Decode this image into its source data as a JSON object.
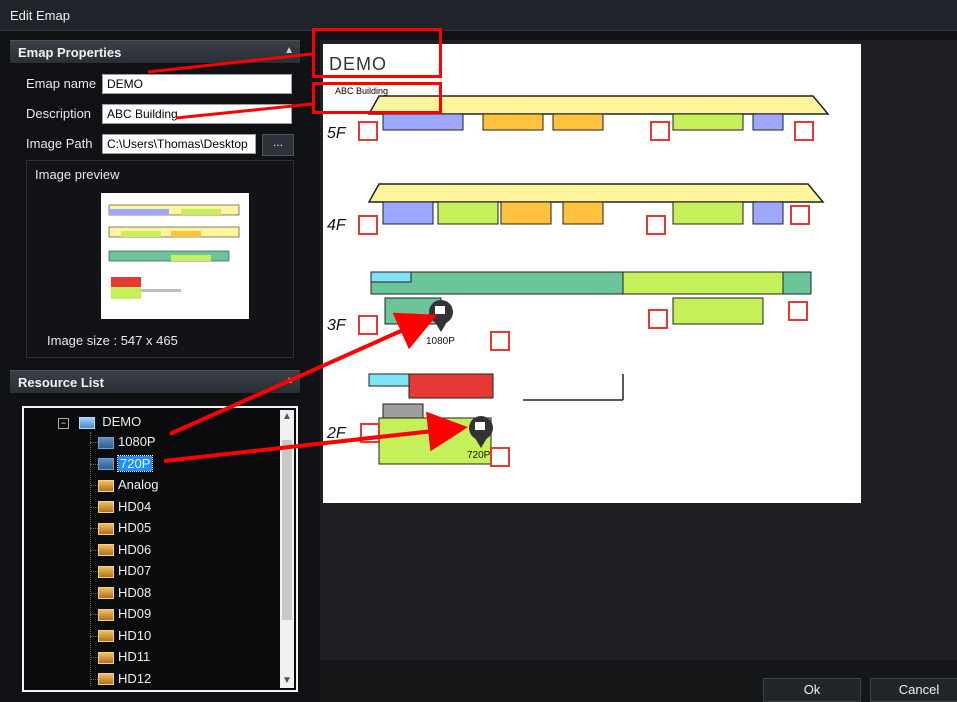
{
  "window": {
    "title": "Edit Emap"
  },
  "properties": {
    "header": "Emap Properties",
    "emap_name_label": "Emap name",
    "emap_name_value": "DEMO",
    "description_label": "Description",
    "description_value": "ABC Building",
    "image_path_label": "Image Path",
    "image_path_value": "C:\\Users\\Thomas\\Desktop",
    "browse_label": "...",
    "preview_title": "Image preview",
    "image_size": "Image size : 547 x 465"
  },
  "resources": {
    "header": "Resource List",
    "root": "DEMO",
    "items": [
      {
        "label": "1080P",
        "icon": "camera-icon"
      },
      {
        "label": "720P",
        "icon": "camera-icon",
        "selected": true
      },
      {
        "label": "Analog",
        "icon": "device-icon"
      },
      {
        "label": "HD04",
        "icon": "device-icon"
      },
      {
        "label": "HD05",
        "icon": "device-icon"
      },
      {
        "label": "HD06",
        "icon": "device-icon"
      },
      {
        "label": "HD07",
        "icon": "device-icon"
      },
      {
        "label": "HD08",
        "icon": "device-icon"
      },
      {
        "label": "HD09",
        "icon": "device-icon"
      },
      {
        "label": "HD10",
        "icon": "device-icon"
      },
      {
        "label": "HD11",
        "icon": "device-icon"
      },
      {
        "label": "HD12",
        "icon": "device-icon"
      }
    ]
  },
  "map": {
    "title": "DEMO",
    "subtitle": "ABC Building",
    "floors": [
      "5F",
      "4F",
      "3F",
      "2F"
    ],
    "markers": [
      "1080P",
      "720P"
    ]
  },
  "buttons": {
    "ok": "Ok",
    "cancel": "Cancel"
  },
  "colors": {
    "accent_red": "#ff0000",
    "selected_bg": "#1e90ff"
  }
}
